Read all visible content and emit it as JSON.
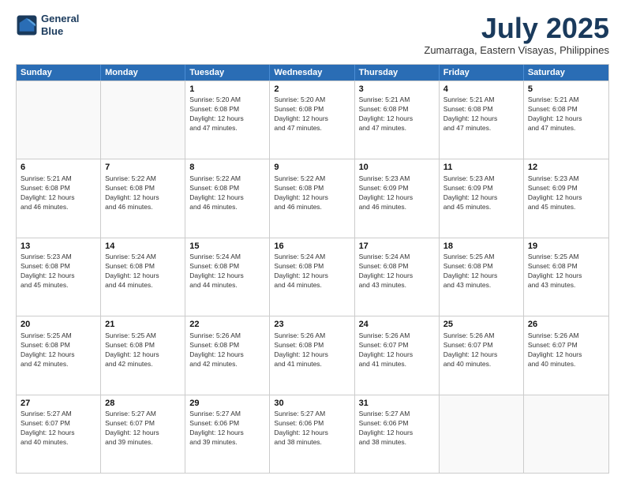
{
  "header": {
    "logo_line1": "General",
    "logo_line2": "Blue",
    "month_title": "July 2025",
    "location": "Zumarraga, Eastern Visayas, Philippines"
  },
  "calendar": {
    "weekdays": [
      "Sunday",
      "Monday",
      "Tuesday",
      "Wednesday",
      "Thursday",
      "Friday",
      "Saturday"
    ],
    "rows": [
      [
        {
          "day": "",
          "empty": true
        },
        {
          "day": "",
          "empty": true
        },
        {
          "day": "1",
          "info": "Sunrise: 5:20 AM\nSunset: 6:08 PM\nDaylight: 12 hours\nand 47 minutes."
        },
        {
          "day": "2",
          "info": "Sunrise: 5:20 AM\nSunset: 6:08 PM\nDaylight: 12 hours\nand 47 minutes."
        },
        {
          "day": "3",
          "info": "Sunrise: 5:21 AM\nSunset: 6:08 PM\nDaylight: 12 hours\nand 47 minutes."
        },
        {
          "day": "4",
          "info": "Sunrise: 5:21 AM\nSunset: 6:08 PM\nDaylight: 12 hours\nand 47 minutes."
        },
        {
          "day": "5",
          "info": "Sunrise: 5:21 AM\nSunset: 6:08 PM\nDaylight: 12 hours\nand 47 minutes."
        }
      ],
      [
        {
          "day": "6",
          "info": "Sunrise: 5:21 AM\nSunset: 6:08 PM\nDaylight: 12 hours\nand 46 minutes."
        },
        {
          "day": "7",
          "info": "Sunrise: 5:22 AM\nSunset: 6:08 PM\nDaylight: 12 hours\nand 46 minutes."
        },
        {
          "day": "8",
          "info": "Sunrise: 5:22 AM\nSunset: 6:08 PM\nDaylight: 12 hours\nand 46 minutes."
        },
        {
          "day": "9",
          "info": "Sunrise: 5:22 AM\nSunset: 6:08 PM\nDaylight: 12 hours\nand 46 minutes."
        },
        {
          "day": "10",
          "info": "Sunrise: 5:23 AM\nSunset: 6:09 PM\nDaylight: 12 hours\nand 46 minutes."
        },
        {
          "day": "11",
          "info": "Sunrise: 5:23 AM\nSunset: 6:09 PM\nDaylight: 12 hours\nand 45 minutes."
        },
        {
          "day": "12",
          "info": "Sunrise: 5:23 AM\nSunset: 6:09 PM\nDaylight: 12 hours\nand 45 minutes."
        }
      ],
      [
        {
          "day": "13",
          "info": "Sunrise: 5:23 AM\nSunset: 6:08 PM\nDaylight: 12 hours\nand 45 minutes."
        },
        {
          "day": "14",
          "info": "Sunrise: 5:24 AM\nSunset: 6:08 PM\nDaylight: 12 hours\nand 44 minutes."
        },
        {
          "day": "15",
          "info": "Sunrise: 5:24 AM\nSunset: 6:08 PM\nDaylight: 12 hours\nand 44 minutes."
        },
        {
          "day": "16",
          "info": "Sunrise: 5:24 AM\nSunset: 6:08 PM\nDaylight: 12 hours\nand 44 minutes."
        },
        {
          "day": "17",
          "info": "Sunrise: 5:24 AM\nSunset: 6:08 PM\nDaylight: 12 hours\nand 43 minutes."
        },
        {
          "day": "18",
          "info": "Sunrise: 5:25 AM\nSunset: 6:08 PM\nDaylight: 12 hours\nand 43 minutes."
        },
        {
          "day": "19",
          "info": "Sunrise: 5:25 AM\nSunset: 6:08 PM\nDaylight: 12 hours\nand 43 minutes."
        }
      ],
      [
        {
          "day": "20",
          "info": "Sunrise: 5:25 AM\nSunset: 6:08 PM\nDaylight: 12 hours\nand 42 minutes."
        },
        {
          "day": "21",
          "info": "Sunrise: 5:25 AM\nSunset: 6:08 PM\nDaylight: 12 hours\nand 42 minutes."
        },
        {
          "day": "22",
          "info": "Sunrise: 5:26 AM\nSunset: 6:08 PM\nDaylight: 12 hours\nand 42 minutes."
        },
        {
          "day": "23",
          "info": "Sunrise: 5:26 AM\nSunset: 6:08 PM\nDaylight: 12 hours\nand 41 minutes."
        },
        {
          "day": "24",
          "info": "Sunrise: 5:26 AM\nSunset: 6:07 PM\nDaylight: 12 hours\nand 41 minutes."
        },
        {
          "day": "25",
          "info": "Sunrise: 5:26 AM\nSunset: 6:07 PM\nDaylight: 12 hours\nand 40 minutes."
        },
        {
          "day": "26",
          "info": "Sunrise: 5:26 AM\nSunset: 6:07 PM\nDaylight: 12 hours\nand 40 minutes."
        }
      ],
      [
        {
          "day": "27",
          "info": "Sunrise: 5:27 AM\nSunset: 6:07 PM\nDaylight: 12 hours\nand 40 minutes."
        },
        {
          "day": "28",
          "info": "Sunrise: 5:27 AM\nSunset: 6:07 PM\nDaylight: 12 hours\nand 39 minutes."
        },
        {
          "day": "29",
          "info": "Sunrise: 5:27 AM\nSunset: 6:06 PM\nDaylight: 12 hours\nand 39 minutes."
        },
        {
          "day": "30",
          "info": "Sunrise: 5:27 AM\nSunset: 6:06 PM\nDaylight: 12 hours\nand 38 minutes."
        },
        {
          "day": "31",
          "info": "Sunrise: 5:27 AM\nSunset: 6:06 PM\nDaylight: 12 hours\nand 38 minutes."
        },
        {
          "day": "",
          "empty": true
        },
        {
          "day": "",
          "empty": true
        }
      ]
    ]
  }
}
